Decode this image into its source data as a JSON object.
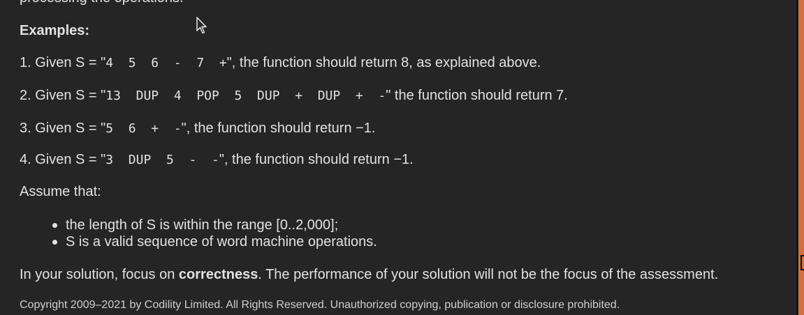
{
  "top_cut_text": "processing the operations.",
  "examples_heading": "Examples:",
  "examples": [
    {
      "prefix": "1. Given S = \"",
      "code": "4  5  6  -  7  +",
      "suffix": "\", the function should return 8, as explained above."
    },
    {
      "prefix": "2. Given S = \"",
      "code": "13  DUP  4  POP  5  DUP  +  DUP  +  -",
      "suffix": "\" the function should return 7."
    },
    {
      "prefix": "3. Given S = \"",
      "code": "5  6  +  -",
      "suffix": "\", the function should return −1."
    },
    {
      "prefix": "4. Given S = \"",
      "code": "3  DUP  5  -  -",
      "suffix": "\", the function should return −1."
    }
  ],
  "assume_heading": "Assume that:",
  "assumptions": [
    "the length of S is within the range [0..2,000];",
    "S is a valid sequence of word machine operations."
  ],
  "focus": {
    "before": "In your solution, focus on ",
    "emphasis": "correctness",
    "after": ". The performance of your solution will not be the focus of the assessment."
  },
  "copyright": "Copyright 2009–2021 by Codility Limited. All Rights Reserved. Unauthorized copying, publication or disclosure prohibited.",
  "colors": {
    "background": "#252525",
    "text": "#e2e2e2",
    "scrollbar": "#d4703f"
  },
  "icons": {
    "cursor": "mouse-pointer-icon"
  }
}
